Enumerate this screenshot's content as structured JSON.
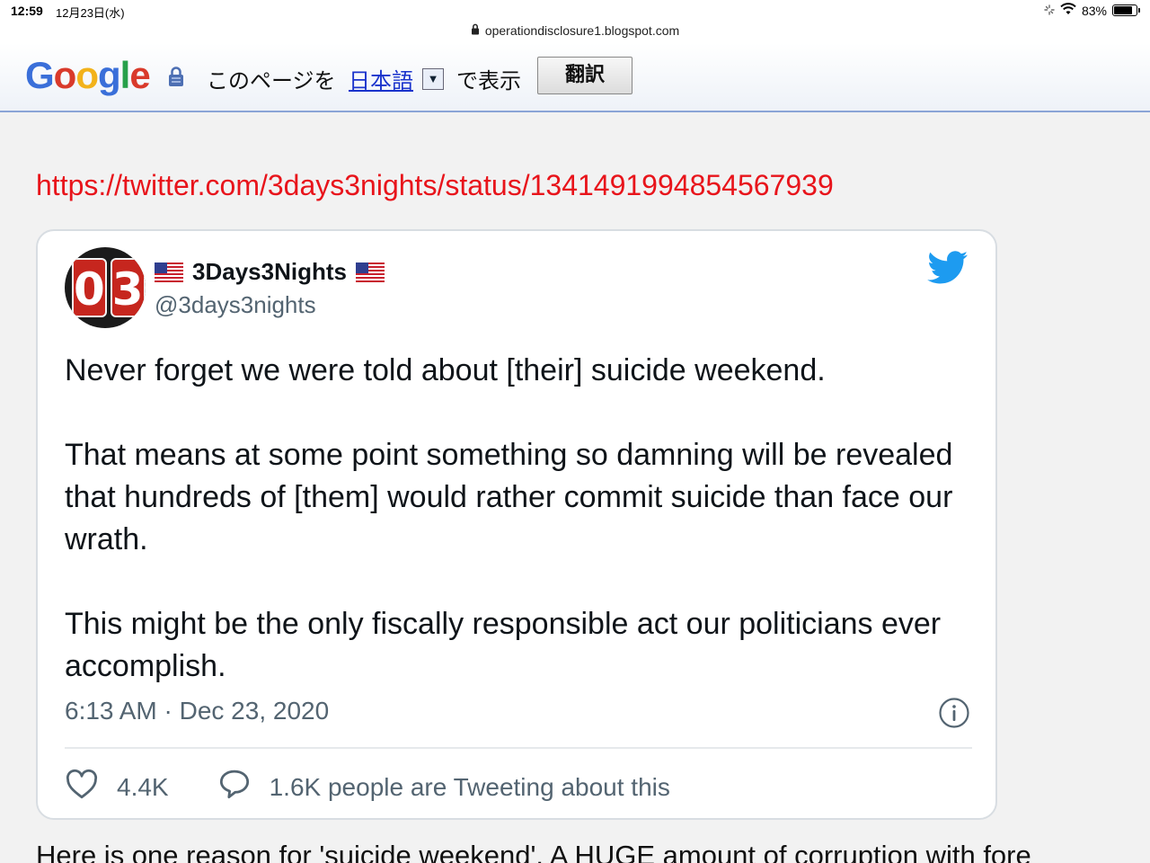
{
  "status_bar": {
    "time": "12:59",
    "date": "12月23日(水)",
    "battery": "83%",
    "battery_level": 0.83
  },
  "browser": {
    "url": "operationdisclosure1.blogspot.com"
  },
  "translate_bar": {
    "logo": "Google",
    "label": "このページを",
    "language": "日本語",
    "suffix": "で表示",
    "button": "翻訳"
  },
  "post": {
    "link": "https://twitter.com/3days3nights/status/1341491994854567939",
    "next_paragraph": "Here is one reason for 'suicide weekend'. A HUGE amount of corruption with fore"
  },
  "tweet": {
    "avatar_text": "03",
    "display_name": "3Days3Nights",
    "handle": "@3days3nights",
    "paragraphs": [
      "Never forget we were told about [their] suicide weekend.",
      "That means at some point something so damning will be revealed that hundreds of [them] would rather commit suicide than face our wrath.",
      "This might be the only fiscally responsible act our politicians ever accomplish."
    ],
    "timestamp": "6:13 AM · Dec 23, 2020",
    "likes": "4.4K",
    "replies_text": "1.6K people are Tweeting about this"
  },
  "colors": {
    "link_red": "#e8141b",
    "twitter_blue": "#1d9bf0",
    "muted_gray": "#536471"
  }
}
